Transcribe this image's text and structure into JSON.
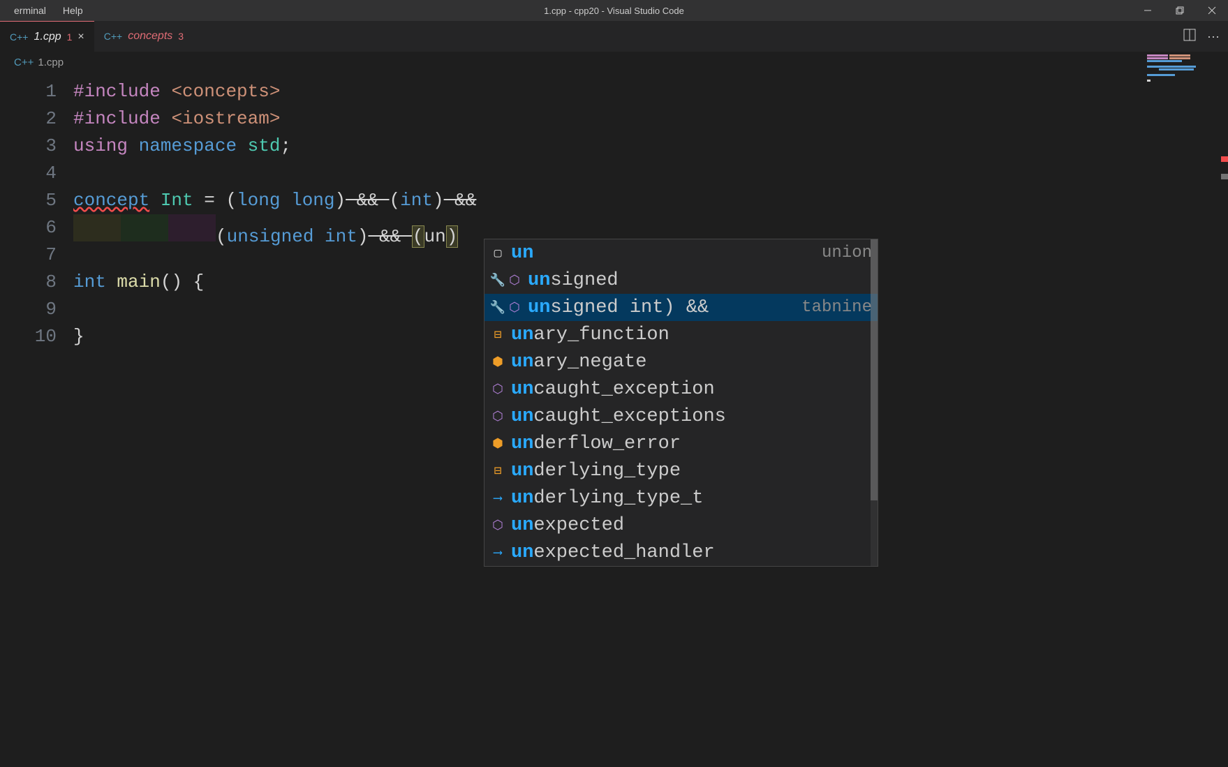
{
  "titlebar": {
    "menu": [
      "erminal",
      "Help"
    ],
    "title": "1.cpp - cpp20 - Visual Studio Code"
  },
  "tabs": [
    {
      "icon": "C++",
      "label": "1.cpp",
      "badge": "1",
      "close": "×",
      "active": true
    },
    {
      "icon": "C++",
      "label": "concepts",
      "badge": "3",
      "active": false
    }
  ],
  "breadcrumbs": {
    "icon": "C++",
    "path": "1.cpp"
  },
  "gutter": {
    "lines": [
      "1",
      "2",
      "3",
      "4",
      "5",
      "6",
      "7",
      "8",
      "9",
      "10"
    ]
  },
  "code": {
    "line1": {
      "include": "#include",
      "header": "<concepts>"
    },
    "line2": {
      "include": "#include",
      "header": "<iostream>"
    },
    "line3": {
      "using": "using",
      "namespace": "namespace",
      "std": "std",
      "semi": ";"
    },
    "line5": {
      "concept": "concept",
      "name": "Int",
      "eq": " = ",
      "open1": "(",
      "type1a": "long",
      "type1b": "long",
      "close1": ")",
      "and1": " && ",
      "open2": "(",
      "type2": "int",
      "close2": ")",
      "and2": " &&"
    },
    "line6": {
      "open1": "(",
      "type1a": "unsigned",
      "type1b": "int",
      "close1": ")",
      "and1": " && ",
      "open2": "(",
      "text": "un",
      "close2": ")"
    },
    "line8": {
      "type": "int",
      "name": "main",
      "parens": "()",
      "brace": " {"
    },
    "line10": {
      "brace": "}"
    }
  },
  "suggest": {
    "items": [
      {
        "icon": "snippet",
        "prefix": "un",
        "rest": "",
        "detail": "union"
      },
      {
        "icon": "wrench-cube",
        "prefix": "un",
        "rest": "signed"
      },
      {
        "icon": "wrench-cube",
        "prefix": "un",
        "rest": "signed int) &&",
        "detail": "tabnine",
        "selected": true
      },
      {
        "icon": "struct",
        "prefix": "un",
        "rest": "ary_function"
      },
      {
        "icon": "class",
        "prefix": "un",
        "rest": "ary_negate"
      },
      {
        "icon": "method",
        "prefix": "un",
        "rest": "caught_exception"
      },
      {
        "icon": "method",
        "prefix": "un",
        "rest": "caught_exceptions"
      },
      {
        "icon": "class",
        "prefix": "un",
        "rest": "derflow_error"
      },
      {
        "icon": "struct",
        "prefix": "un",
        "rest": "derlying_type"
      },
      {
        "icon": "type",
        "prefix": "un",
        "rest": "derlying_type_t"
      },
      {
        "icon": "method",
        "prefix": "un",
        "rest": "expected"
      },
      {
        "icon": "type",
        "prefix": "un",
        "rest": "expected_handler"
      }
    ]
  }
}
